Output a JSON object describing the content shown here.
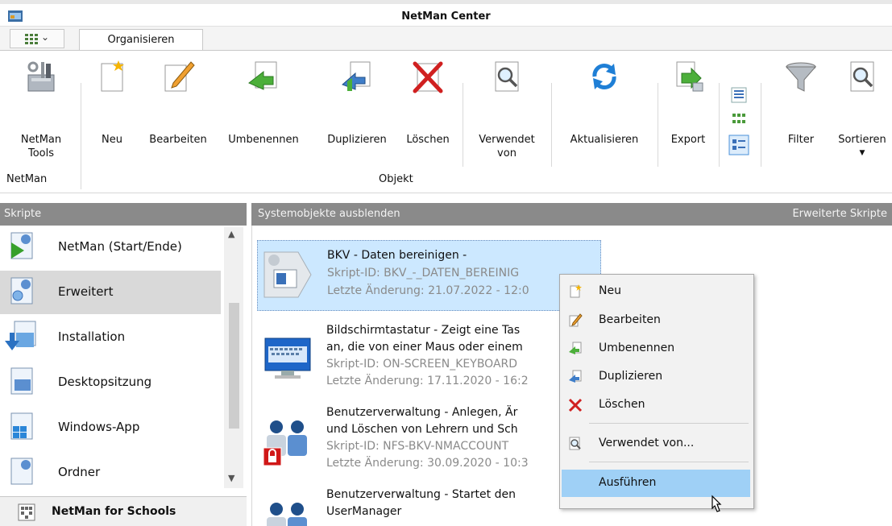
{
  "window": {
    "title": "NetMan Center"
  },
  "tabs": {
    "quick_access_chevron": "⌄",
    "active_tab": "Organisieren"
  },
  "ribbon": {
    "netman_tools": "NetMan Tools",
    "neu": "Neu",
    "bearbeiten": "Bearbeiten",
    "umbenennen": "Umbenennen",
    "duplizieren": "Duplizieren",
    "loeschen": "Löschen",
    "verwendet_von": "Verwendet von",
    "aktualisieren": "Aktualisieren",
    "export": "Export",
    "filter": "Filter",
    "sortieren": "Sortieren",
    "group_netman": "NetMan",
    "group_objekt": "Objekt"
  },
  "left_pane": {
    "header": "Skripte",
    "items": [
      {
        "label": "NetMan (Start/Ende)"
      },
      {
        "label": "Erweitert"
      },
      {
        "label": "Installation"
      },
      {
        "label": "Desktopsitzung"
      },
      {
        "label": "Windows-App"
      },
      {
        "label": "Ordner"
      }
    ],
    "footer": "NetMan for Schools"
  },
  "right_pane": {
    "header_left": "Systemobjekte ausblenden",
    "header_right": "Erweiterte Skripte",
    "items": [
      {
        "title": "BKV - Daten bereinigen -",
        "line2": "Skript-ID: BKV_-_DATEN_BEREINIG",
        "line3": "Letzte Änderung: 21.07.2022 - 12:0"
      },
      {
        "title": "Bildschirmtastatur - Zeigt eine Tas",
        "title2": "an, die von einer Maus oder einem",
        "line2": "Skript-ID: ON-SCREEN_KEYBOARD",
        "line3": "Letzte Änderung: 17.11.2020 - 16:2"
      },
      {
        "title": "Benutzerverwaltung - Anlegen, Är",
        "title2": "und Löschen von Lehrern und Sch",
        "line2": "Skript-ID: NFS-BKV-NMACCOUNT",
        "line3": "Letzte Änderung: 30.09.2020 - 10:3"
      },
      {
        "title": "Benutzerverwaltung - Startet den",
        "title2": "UserManager"
      }
    ]
  },
  "context_menu": {
    "items": [
      "Neu",
      "Bearbeiten",
      "Umbenennen",
      "Duplizieren",
      "Löschen",
      "Verwendet von...",
      "Ausführen"
    ],
    "highlighted": "Ausführen"
  },
  "colors": {
    "panel_header": "#8a8a8a",
    "selection": "#cce8ff",
    "menu_highlight": "#9fd0f6",
    "list_selected": "#d9d9d9"
  }
}
